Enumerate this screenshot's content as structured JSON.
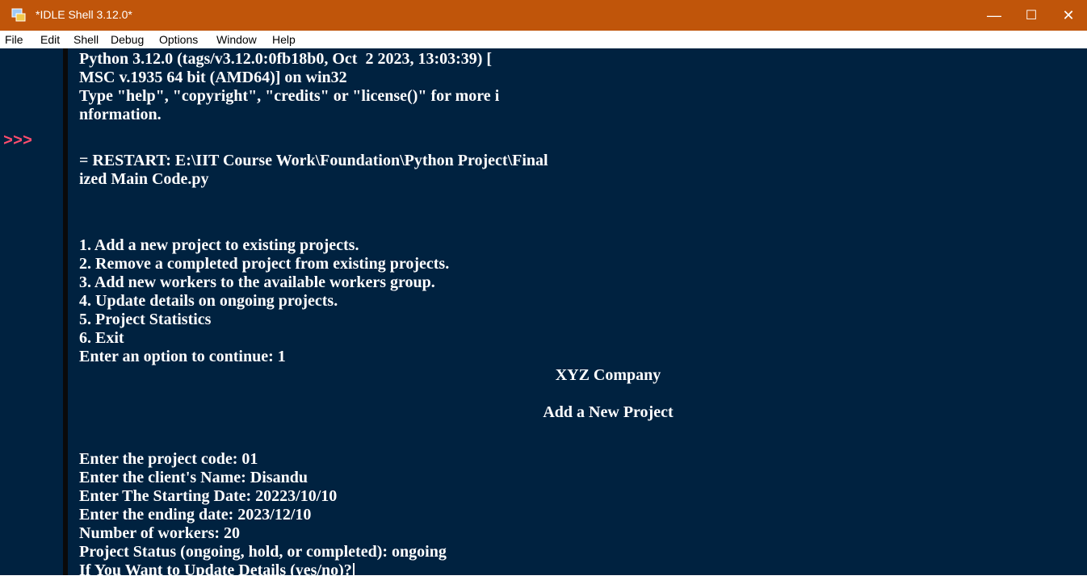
{
  "window": {
    "title": "*IDLE Shell 3.12.0*",
    "minimize": "—",
    "maximize": "☐",
    "close": "✕"
  },
  "menu": [
    "File",
    "Edit",
    "Shell",
    "Debug",
    "Options",
    "Window",
    "Help"
  ],
  "shell": {
    "prompt": ">>>",
    "lines": [
      "Python 3.12.0 (tags/v3.12.0:0fb18b0, Oct  2 2023, 13:03:39) [",
      "MSC v.1935 64 bit (AMD64)] on win32",
      "Type \"help\", \"copyright\", \"credits\" or \"license()\" for more i",
      "nformation.",
      "= RESTART: E:\\IIT Course Work\\Foundation\\Python Project\\Final",
      "ized Main Code.py",
      "1. Add a new project to existing projects.",
      "2. Remove a completed project from existing projects.",
      "3. Add new workers to the available workers group.",
      "4. Update details on ongoing projects.",
      "5. Project Statistics",
      "6. Exit",
      "Enter an option to continue: 1",
      "XYZ Company",
      "Add a New Project",
      "Enter the project code: 01",
      "Enter the client's Name: Disandu",
      "Enter The Starting Date: 20223/10/10",
      "Enter the ending date: 2023/12/10",
      "Number of workers: 20",
      "Project Status (ongoing, hold, or completed): ongoing",
      "If You Want to Update Details (yes/no)?"
    ]
  },
  "colors": {
    "background": "#002240",
    "titlebar": "#c0550a",
    "prompt": "#ff4d6d",
    "text": "#ffffff"
  }
}
